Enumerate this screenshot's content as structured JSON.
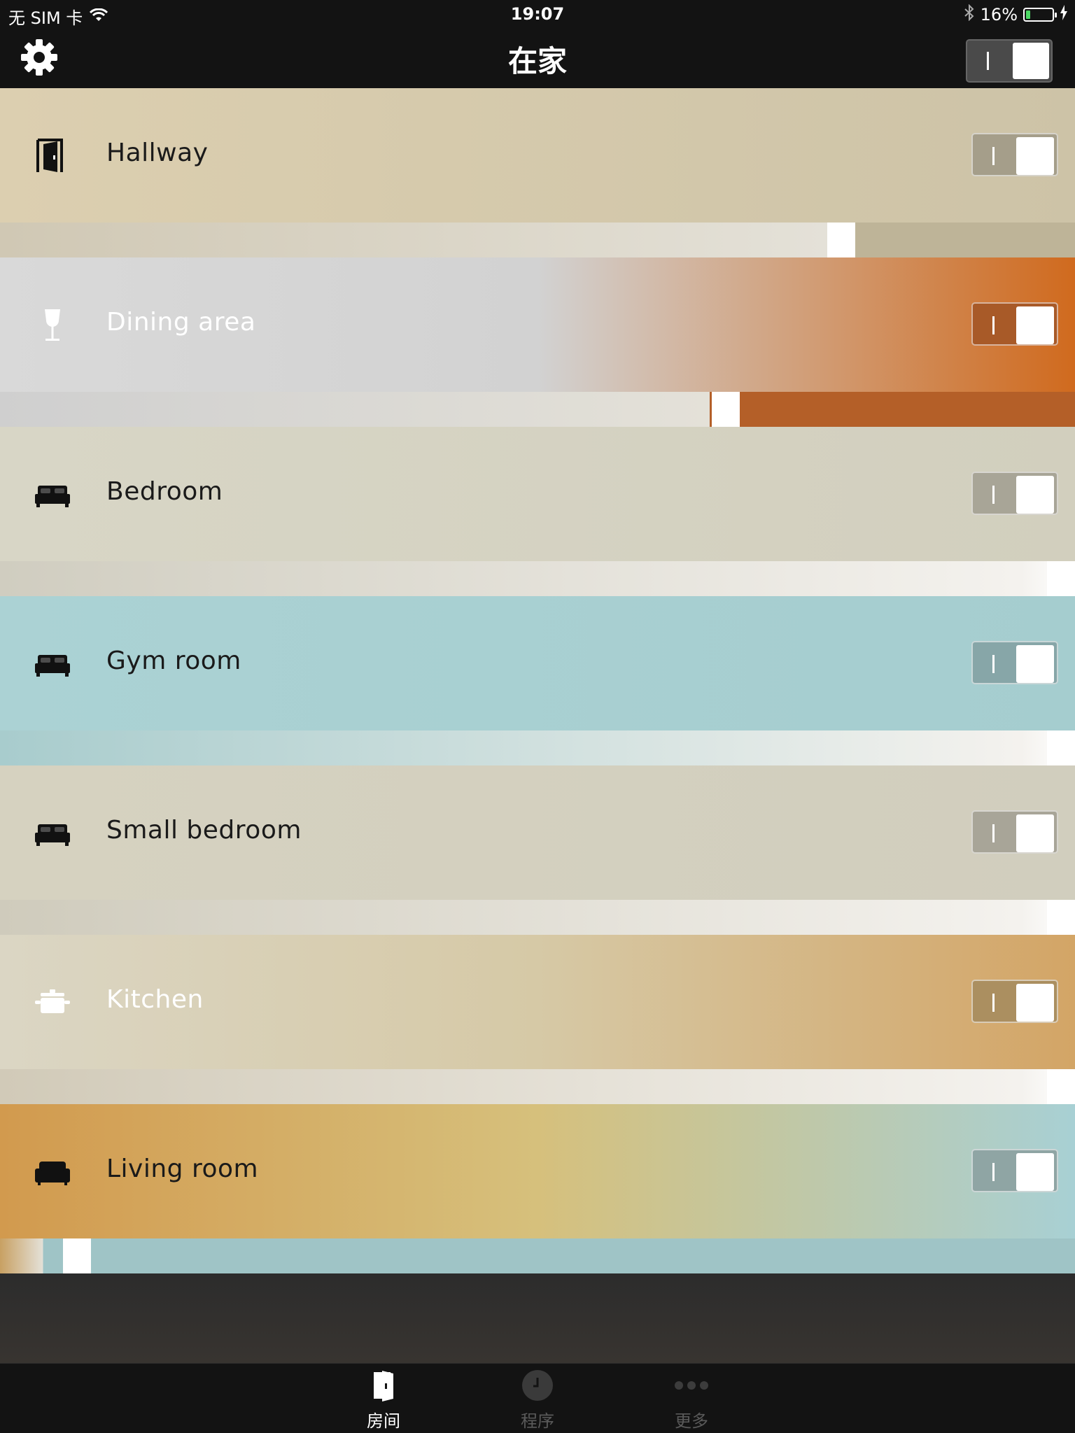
{
  "status_bar": {
    "carrier": "无 SIM 卡",
    "time": "19:07",
    "battery_text": "16%",
    "battery_level": 0.16
  },
  "header": {
    "title": "在家",
    "master_toggle_on": true
  },
  "rooms": [
    {
      "name": "Hallway",
      "icon": "door-icon",
      "on": true,
      "brightness": 0.79,
      "label_color": "dark",
      "colors": {
        "top_left": "#dccfb0",
        "top_right": "#cdc3a7",
        "bar_left": "#d0c8b4",
        "bar_right": "#beb498",
        "toggle": "#a59e8a"
      }
    },
    {
      "name": "Dining area",
      "icon": "wine-glass-icon",
      "on": true,
      "brightness": 0.68,
      "label_color": "light",
      "colors": {
        "top_left": "#d9d9d9",
        "top_mid": "#d2d2d2",
        "top_right": "#d06a1e",
        "bar_left": "#cfcfcf",
        "bar_right": "#b45f28",
        "toggle": "#a85a28"
      }
    },
    {
      "name": "Bedroom",
      "icon": "bed-icon",
      "on": true,
      "brightness": 1.0,
      "label_color": "dark",
      "colors": {
        "top_left": "#d8d6c6",
        "top_right": "#d2cfbe",
        "bar_left": "#d0cdc0",
        "bar_right": "#ffffff",
        "toggle": "#a8a597"
      }
    },
    {
      "name": "Gym room",
      "icon": "bed-icon",
      "on": true,
      "brightness": 1.0,
      "label_color": "dark",
      "colors": {
        "top_left": "#abd2d4",
        "top_right": "#a5cdcf",
        "bar_left": "#a8cccd",
        "bar_right": "#ffffff",
        "toggle": "#87a6a8"
      }
    },
    {
      "name": "Small bedroom",
      "icon": "bed-icon",
      "on": true,
      "brightness": 1.0,
      "label_color": "dark",
      "colors": {
        "top_left": "#d6d2c0",
        "top_right": "#d1cebe",
        "bar_left": "#cfcbbc",
        "bar_right": "#ffffff",
        "toggle": "#a8a598"
      }
    },
    {
      "name": "Kitchen",
      "icon": "pot-icon",
      "on": true,
      "brightness": 1.0,
      "label_color": "light",
      "colors": {
        "top_left": "#dbd6c4",
        "top_mid": "#d6c9a6",
        "top_right": "#d3a566",
        "bar_left": "#d1cab8",
        "bar_right": "#ffffff",
        "toggle": "#ab8f60"
      }
    },
    {
      "name": "Living room",
      "icon": "sofa-icon",
      "on": true,
      "brightness": 0.06,
      "label_color": "dark",
      "colors": {
        "top_left": "#d29a4e",
        "top_mid": "#d6c07c",
        "top_right": "#a8d0d4",
        "bar_left": "#c8a062",
        "bar_right": "#9fc4c6",
        "toggle": "#8fa5a4"
      }
    }
  ],
  "tabs": [
    {
      "label": "房间",
      "icon": "room-door-icon",
      "active": true
    },
    {
      "label": "程序",
      "icon": "clock-icon",
      "active": false
    },
    {
      "label": "更多",
      "icon": "more-dots-icon",
      "active": false
    }
  ]
}
